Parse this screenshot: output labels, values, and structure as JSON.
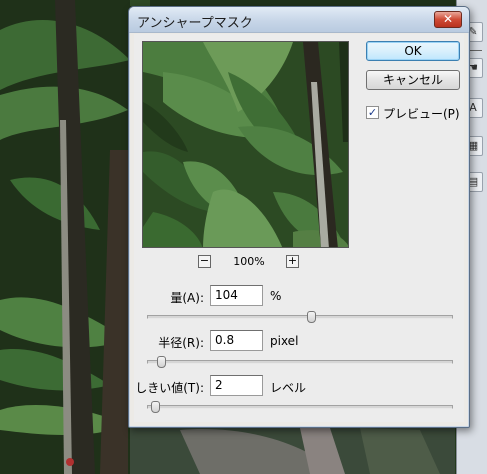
{
  "dialog": {
    "title": "アンシャープマスク",
    "close_label": "✕",
    "ok_label": "OK",
    "cancel_label": "キャンセル",
    "preview_check": {
      "label": "プレビュー(P)",
      "checked": true,
      "mark": "✓"
    },
    "zoom": {
      "minus_label": "−",
      "value": "100%",
      "plus_label": "+"
    },
    "params": [
      {
        "label": "量(A):",
        "value": "104",
        "unit": "%",
        "slider_fraction": 0.54
      },
      {
        "label": "半径(R):",
        "value": "0.8",
        "unit": "pixel",
        "slider_fraction": 0.03
      },
      {
        "label": "しきい値(T):",
        "value": "2",
        "unit": "レベル",
        "slider_fraction": 0.01
      }
    ]
  },
  "app_toolbar": {
    "icons": [
      "brush-icon",
      "hand-icon",
      "text-icon",
      "grid-icon"
    ]
  },
  "colors": {
    "titlebar": "#c7d6e8",
    "close_button": "#cf4b36",
    "default_button": "#d9f0fc",
    "foliage_dark": "#23361f",
    "leaf": "#3f6b34"
  }
}
